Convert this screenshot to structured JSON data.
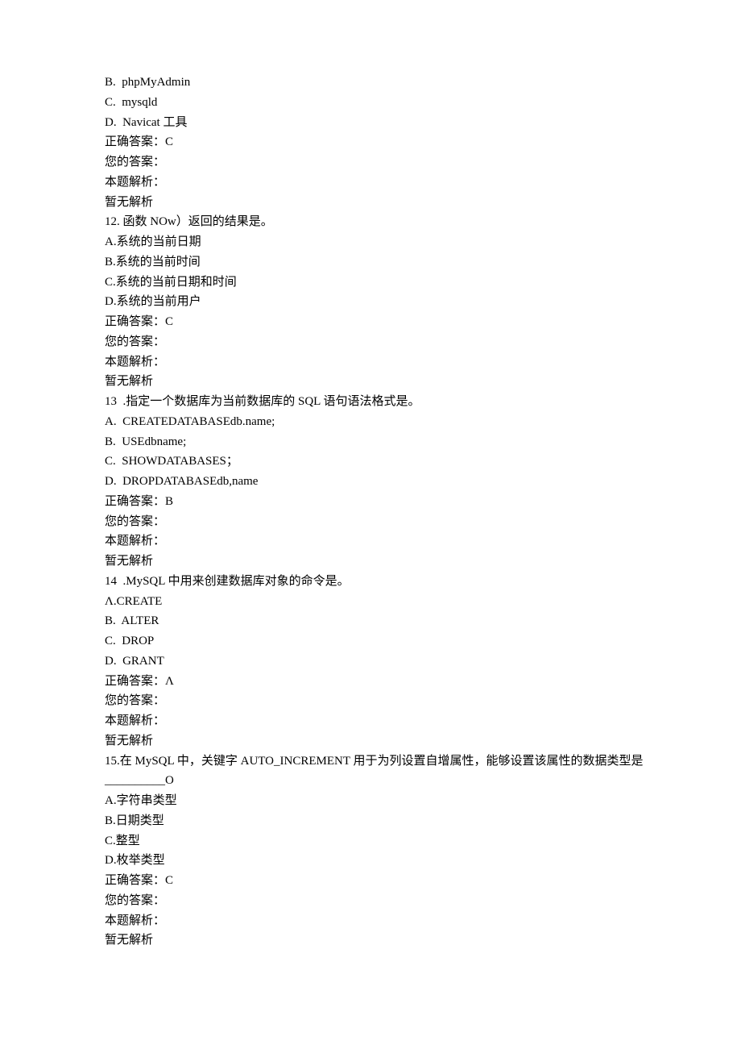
{
  "lines": [
    "B.  phpMyAdmin",
    "C.  mysqld",
    "D.  Navicat 工具",
    "正确答案：C",
    "您的答案：",
    "本题解析：",
    "暂无解析",
    "12. 函数 NOw）返回的结果是。",
    "A.系统的当前日期",
    "B.系统的当前时间",
    "C.系统的当前日期和时间",
    "D.系统的当前用户",
    "正确答案：C",
    "您的答案：",
    "本题解析：",
    "暂无解析",
    "13  .指定一个数据库为当前数据库的 SQL 语句语法格式是。",
    "A.  CREATEDATABASEdb.name;",
    "B.  USEdbname;",
    "C.  SHOWDATABASES；",
    "D.  DROPDATABASEdb,name",
    "正确答案：B",
    "您的答案：",
    "本题解析：",
    "暂无解析",
    "14  .MySQL 中用来创建数据库对象的命令是。",
    "Λ.CREATE",
    "B.  ALTER",
    "C.  DROP",
    "D.  GRANT",
    "正确答案：Λ",
    "您的答案：",
    "本题解析：",
    "暂无解析",
    "15.在 MySQL 中，关键字 AUTO_INCREMENT 用于为列设置自增属性，能够设置该属性的数据类型是",
    "__________O",
    "A.字符串类型",
    "B.日期类型",
    "C.整型",
    "D.枚举类型",
    "正确答案：C",
    "您的答案：",
    "本题解析：",
    "暂无解析"
  ]
}
